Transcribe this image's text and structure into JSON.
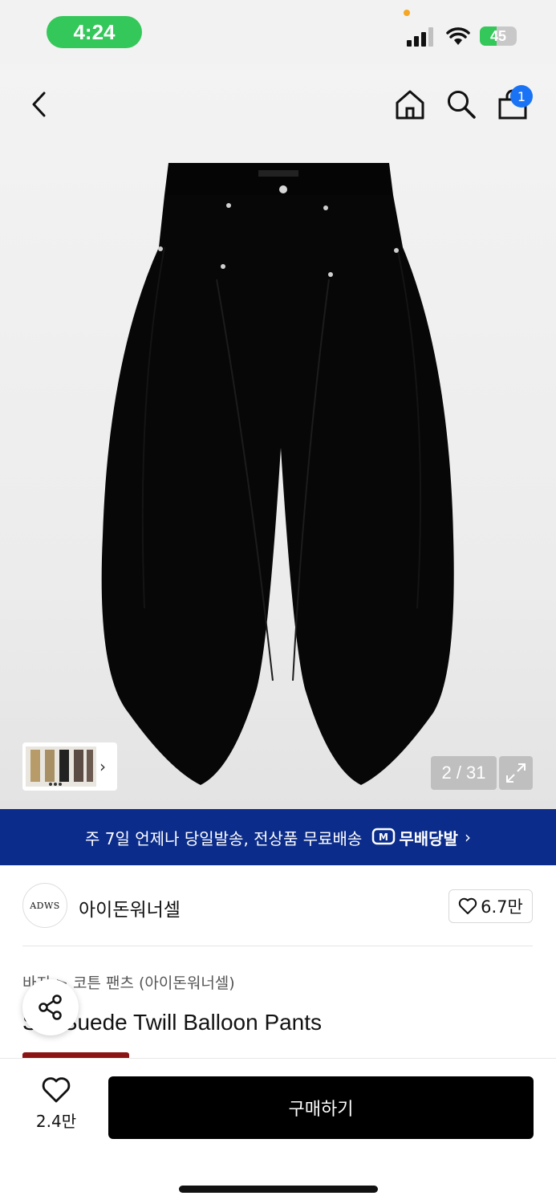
{
  "status_bar": {
    "time": "4:24",
    "battery": "45",
    "battery_level": 0.45,
    "icons": [
      "signal-icon",
      "wifi-icon",
      "battery-icon"
    ]
  },
  "header": {
    "icons": [
      "back-icon",
      "home-icon",
      "search-icon",
      "cart-icon"
    ],
    "cart_badge": "1"
  },
  "gallery": {
    "counter": "2 / 31",
    "icons": [
      "expand-icon",
      "chevron-right-icon"
    ]
  },
  "banner": {
    "text": "주 7일 언제나 당일발송, 전상품 무료배송",
    "logo_text": "무배당발",
    "chevron": "›",
    "color": "#0b2c8a"
  },
  "brand": {
    "logo_text": "ADWS",
    "name": "아이돈워너셀",
    "likes": "6.7만"
  },
  "product": {
    "breadcrumb": [
      "바지",
      "코튼 팬츠 (아이돈워너셀)"
    ],
    "breadcrumb_sep": ">",
    "title": "S... Suede Twill Balloon Pants"
  },
  "bottom_bar": {
    "wish_count": "2.4만",
    "buy_label": "구매하기",
    "buy_color": "#000000"
  }
}
